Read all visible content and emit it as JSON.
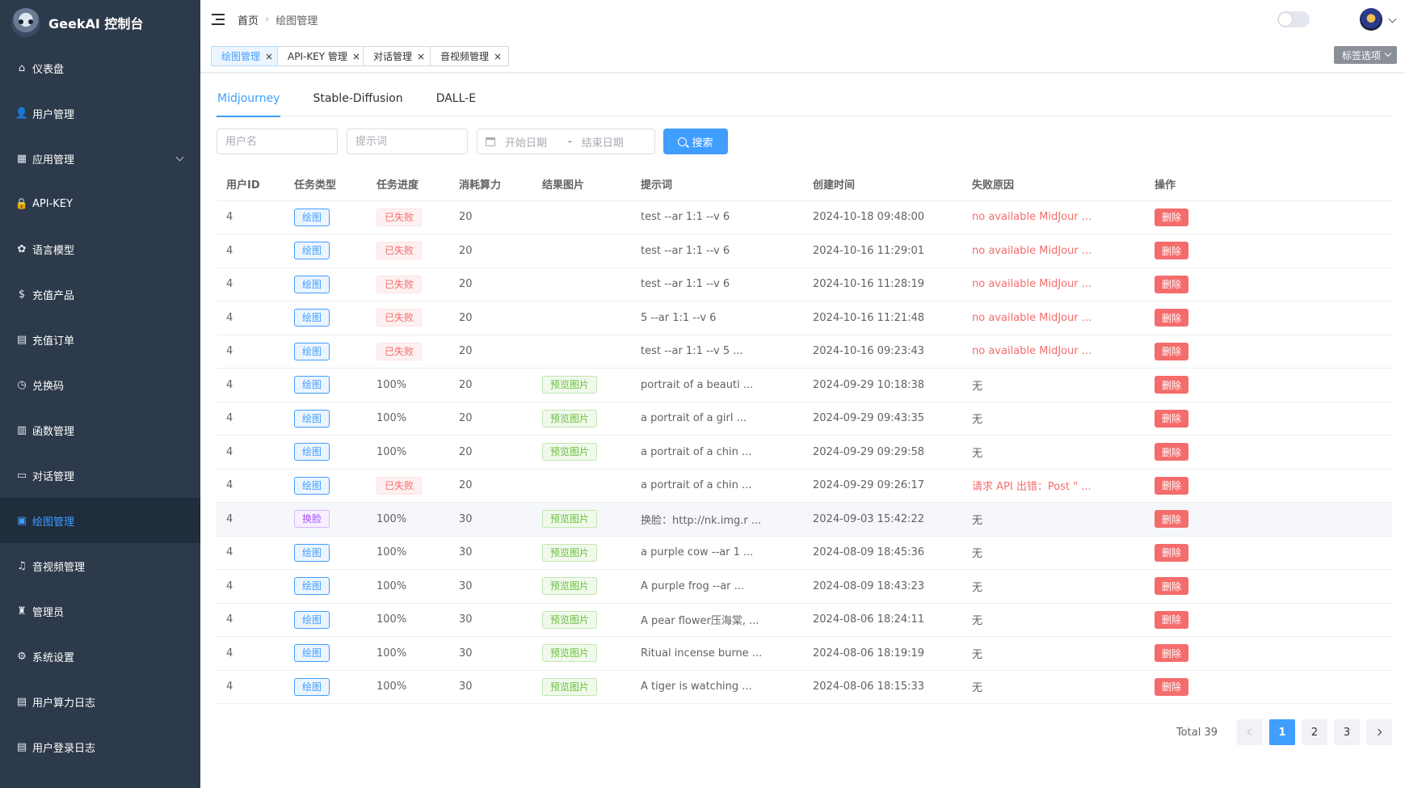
{
  "brand": {
    "title": "GeekAI 控制台"
  },
  "sidebar": {
    "items": [
      {
        "label": "仪表盘",
        "icon": "home-icon",
        "glyph": "⌂"
      },
      {
        "label": "用户管理",
        "icon": "user-icon",
        "glyph": "👤"
      },
      {
        "label": "应用管理",
        "icon": "grid-icon",
        "glyph": "▦",
        "expandable": true
      },
      {
        "label": "API-KEY",
        "icon": "lock-icon",
        "glyph": "🔒"
      },
      {
        "label": "语言模型",
        "icon": "model-icon",
        "glyph": "✿"
      },
      {
        "label": "充值产品",
        "icon": "coin-icon",
        "glyph": "$"
      },
      {
        "label": "充值订单",
        "icon": "order-icon",
        "glyph": "▤"
      },
      {
        "label": "兑换码",
        "icon": "timer-icon",
        "glyph": "◷"
      },
      {
        "label": "函数管理",
        "icon": "function-icon",
        "glyph": "▥"
      },
      {
        "label": "对话管理",
        "icon": "chat-icon",
        "glyph": "▭"
      },
      {
        "label": "绘图管理",
        "icon": "picture-icon",
        "glyph": "▣",
        "active": true
      },
      {
        "label": "音视频管理",
        "icon": "music-icon",
        "glyph": "♫"
      },
      {
        "label": "管理员",
        "icon": "admin-icon",
        "glyph": "♜"
      },
      {
        "label": "系统设置",
        "icon": "gear-icon",
        "glyph": "⚙"
      },
      {
        "label": "用户算力日志",
        "icon": "log-icon",
        "glyph": "▤"
      },
      {
        "label": "用户登录日志",
        "icon": "log-icon",
        "glyph": "▤"
      }
    ]
  },
  "header": {
    "breadcrumb": {
      "home": "首页",
      "separator": "›",
      "current": "绘图管理"
    }
  },
  "tags": {
    "items": [
      {
        "label": "绘图管理",
        "active": true
      },
      {
        "label": "API-KEY 管理"
      },
      {
        "label": "对话管理"
      },
      {
        "label": "音视频管理"
      }
    ],
    "close_glyph": "×",
    "options_label": "标签选项"
  },
  "tabs": [
    {
      "label": "Midjourney",
      "active": true
    },
    {
      "label": "Stable-Diffusion"
    },
    {
      "label": "DALL-E"
    }
  ],
  "filters": {
    "username_placeholder": "用户名",
    "prompt_placeholder": "提示词",
    "date_start_placeholder": "开始日期",
    "date_separator": "-",
    "date_end_placeholder": "结束日期",
    "search_label": "搜索"
  },
  "table": {
    "columns": [
      "用户ID",
      "任务类型",
      "任务进度",
      "消耗算力",
      "结果图片",
      "提示词",
      "创建时间",
      "失败原因",
      "操作"
    ],
    "delete_label": "删除",
    "preview_label": "预览图片",
    "rows": [
      {
        "uid": "4",
        "type": "绘图",
        "type_color": "blue",
        "progress": "已失败",
        "failed": true,
        "power": "20",
        "preview": false,
        "prompt": "test --ar 1:1 --v 6",
        "time": "2024-10-18 09:48:00",
        "reason": "no available MidJour ...",
        "reason_err": true
      },
      {
        "uid": "4",
        "type": "绘图",
        "type_color": "blue",
        "progress": "已失败",
        "failed": true,
        "power": "20",
        "preview": false,
        "prompt": "test --ar 1:1 --v 6",
        "time": "2024-10-16 11:29:01",
        "reason": "no available MidJour ...",
        "reason_err": true
      },
      {
        "uid": "4",
        "type": "绘图",
        "type_color": "blue",
        "progress": "已失败",
        "failed": true,
        "power": "20",
        "preview": false,
        "prompt": "test --ar 1:1 --v 6",
        "time": "2024-10-16 11:28:19",
        "reason": "no available MidJour ...",
        "reason_err": true
      },
      {
        "uid": "4",
        "type": "绘图",
        "type_color": "blue",
        "progress": "已失败",
        "failed": true,
        "power": "20",
        "preview": false,
        "prompt": "5 --ar 1:1 --v 6",
        "time": "2024-10-16 11:21:48",
        "reason": "no available MidJour ...",
        "reason_err": true
      },
      {
        "uid": "4",
        "type": "绘图",
        "type_color": "blue",
        "progress": "已失败",
        "failed": true,
        "power": "20",
        "preview": false,
        "prompt": "test --ar 1:1 --v 5 ...",
        "time": "2024-10-16 09:23:43",
        "reason": "no available MidJour ...",
        "reason_err": true
      },
      {
        "uid": "4",
        "type": "绘图",
        "type_color": "blue",
        "progress": "100%",
        "failed": false,
        "power": "20",
        "preview": true,
        "prompt": "portrait of a beauti ...",
        "time": "2024-09-29 10:18:38",
        "reason": "无",
        "reason_err": false
      },
      {
        "uid": "4",
        "type": "绘图",
        "type_color": "blue",
        "progress": "100%",
        "failed": false,
        "power": "20",
        "preview": true,
        "prompt": "a portrait of a girl ...",
        "time": "2024-09-29 09:43:35",
        "reason": "无",
        "reason_err": false
      },
      {
        "uid": "4",
        "type": "绘图",
        "type_color": "blue",
        "progress": "100%",
        "failed": false,
        "power": "20",
        "preview": true,
        "prompt": "a portrait of a chin ...",
        "time": "2024-09-29 09:29:58",
        "reason": "无",
        "reason_err": false
      },
      {
        "uid": "4",
        "type": "绘图",
        "type_color": "blue",
        "progress": "已失败",
        "failed": true,
        "power": "20",
        "preview": false,
        "prompt": "a portrait of a chin ...",
        "time": "2024-09-29 09:26:17",
        "reason": "请求 API 出错：Post \" ...",
        "reason_err": true
      },
      {
        "uid": "4",
        "type": "换脸",
        "type_color": "purple",
        "progress": "100%",
        "failed": false,
        "power": "30",
        "preview": true,
        "prompt": "换脸：http://nk.img.r ...",
        "time": "2024-09-03 15:42:22",
        "reason": "无",
        "reason_err": false,
        "highlight": true
      },
      {
        "uid": "4",
        "type": "绘图",
        "type_color": "blue",
        "progress": "100%",
        "failed": false,
        "power": "30",
        "preview": true,
        "prompt": "a purple cow --ar 1 ...",
        "time": "2024-08-09 18:45:36",
        "reason": "无",
        "reason_err": false
      },
      {
        "uid": "4",
        "type": "绘图",
        "type_color": "blue",
        "progress": "100%",
        "failed": false,
        "power": "30",
        "preview": true,
        "prompt": "A purple frog --ar ...",
        "time": "2024-08-09 18:43:23",
        "reason": "无",
        "reason_err": false
      },
      {
        "uid": "4",
        "type": "绘图",
        "type_color": "blue",
        "progress": "100%",
        "failed": false,
        "power": "30",
        "preview": true,
        "prompt": "A pear flower压海棠, ...",
        "time": "2024-08-06 18:24:11",
        "reason": "无",
        "reason_err": false
      },
      {
        "uid": "4",
        "type": "绘图",
        "type_color": "blue",
        "progress": "100%",
        "failed": false,
        "power": "30",
        "preview": true,
        "prompt": "Ritual incense burne ...",
        "time": "2024-08-06 18:19:19",
        "reason": "无",
        "reason_err": false
      },
      {
        "uid": "4",
        "type": "绘图",
        "type_color": "blue",
        "progress": "100%",
        "failed": false,
        "power": "30",
        "preview": true,
        "prompt": "A tiger is watching ...",
        "time": "2024-08-06 18:15:33",
        "reason": "无",
        "reason_err": false
      }
    ]
  },
  "pagination": {
    "total_label": "Total 39",
    "pages": [
      "1",
      "2",
      "3"
    ],
    "current": "1"
  },
  "colors": {
    "sidebar_bg": "#2d3a4b",
    "accent": "#409eff",
    "danger": "#f56c6c",
    "success": "#67c23a"
  }
}
